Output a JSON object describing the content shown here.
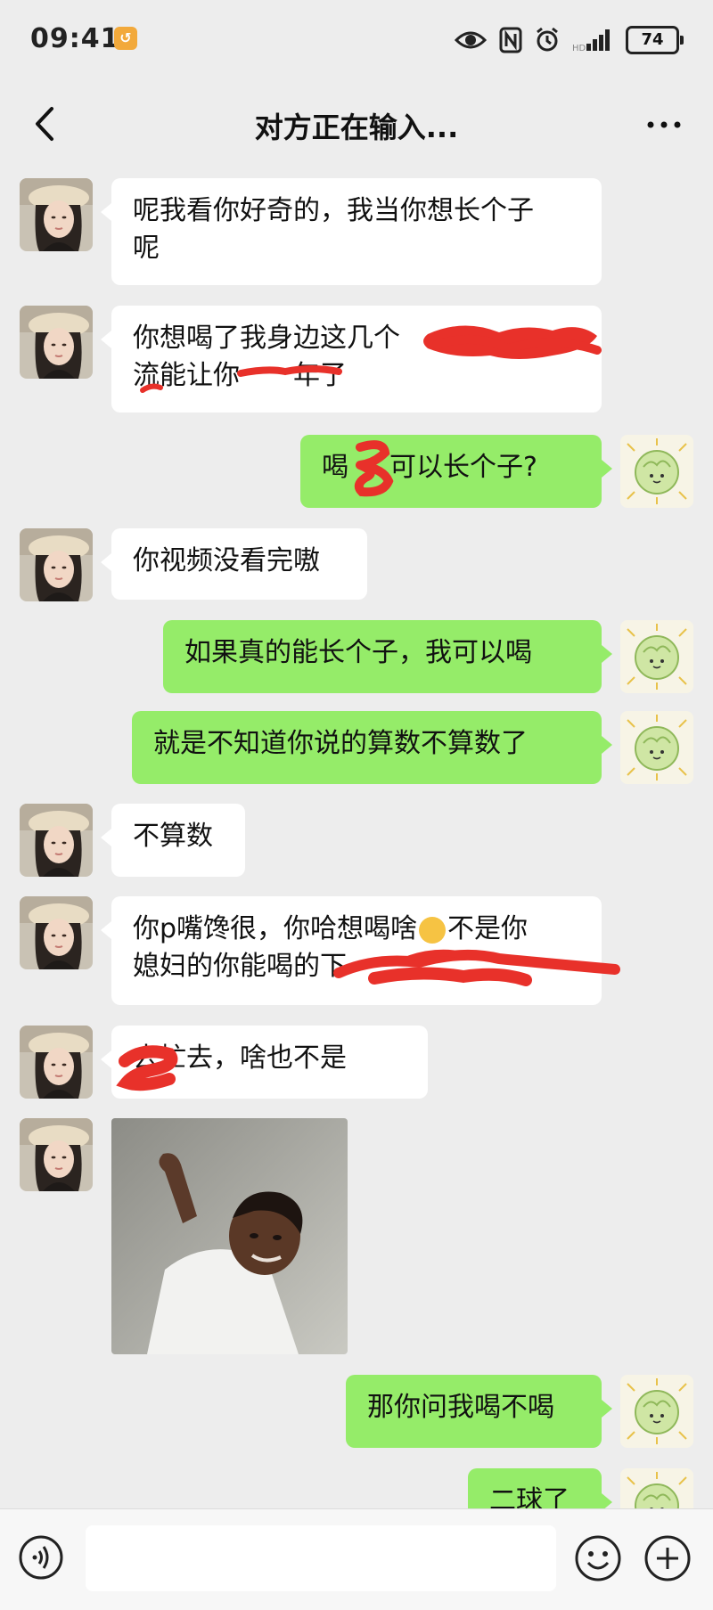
{
  "status_bar": {
    "time": "09:41",
    "battery": "74",
    "icons": [
      "eye-icon",
      "nfc-icon",
      "alarm-icon",
      "signal-icon",
      "battery-icon"
    ]
  },
  "nav": {
    "title": "对方正在输入...",
    "back_icon": "chevron-left-icon",
    "more_icon": "more-icon"
  },
  "messages": [
    {
      "side": "in",
      "lines": [
        "呢我看你好奇的，我当你想长个子",
        "呢"
      ]
    },
    {
      "side": "in",
      "lines": [
        "你想喝了我身边这几个",
        "流能让你",
        "年了"
      ]
    },
    {
      "side": "out",
      "parts": [
        "喝",
        "可以长个子?"
      ]
    },
    {
      "side": "in",
      "lines": [
        "你视频没看完嗷"
      ]
    },
    {
      "side": "out",
      "lines": [
        "如果真的能长个子，我可以喝"
      ]
    },
    {
      "side": "out",
      "lines": [
        "就是不知道你说的算数不算数了"
      ]
    },
    {
      "side": "in",
      "lines": [
        "不算数"
      ]
    },
    {
      "side": "in",
      "lines": [
        "你p嘴馋很，你哈想喝啥",
        "不是你",
        "媳妇的你能喝的",
        "下"
      ]
    },
    {
      "side": "in",
      "lines": [
        "去忙去，啥也不是"
      ]
    },
    {
      "side": "in",
      "type": "image"
    },
    {
      "side": "out",
      "lines": [
        "那你问我喝不喝"
      ]
    },
    {
      "side": "out",
      "lines": [
        "二球了"
      ]
    }
  ],
  "colors": {
    "background": "#ededed",
    "incoming_bubble": "#ffffff",
    "outgoing_bubble": "#95ec69",
    "redaction": "#e8312a"
  },
  "input_bar": {
    "voice_icon": "voice-icon",
    "emoji_icon": "emoji-icon",
    "plus_icon": "plus-icon"
  }
}
